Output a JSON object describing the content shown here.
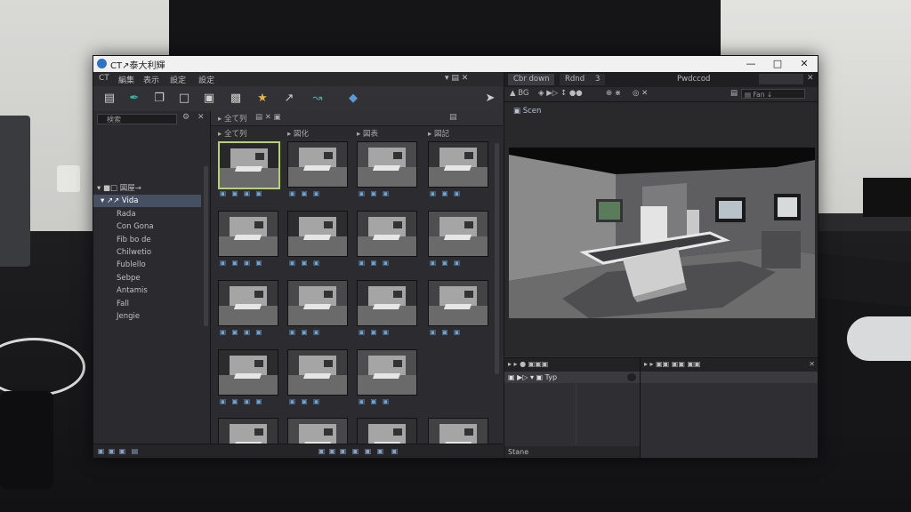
{
  "window": {
    "title": "CT↗泰大利輝"
  },
  "menu": [
    "CT",
    "編集",
    "表示",
    "設定"
  ],
  "toolbar_icons": [
    "list-icon",
    "pen-icon",
    "copy-icon",
    "crop-icon",
    "monitor-icon",
    "layers-icon",
    "star-icon",
    "brush-icon",
    "wand-icon",
    "link-icon",
    "arrow-icon"
  ],
  "tree": {
    "search_placeholder": "検索",
    "items": [
      {
        "label": "▾ ■□ 図屋→",
        "selected": false
      },
      {
        "label": "▾ ↗↗ Vida",
        "selected": true
      },
      {
        "label": "Rada",
        "selected": false
      },
      {
        "label": "Con Gona",
        "selected": false
      },
      {
        "label": "Fib bo de",
        "selected": false
      },
      {
        "label": "Chilwetio",
        "selected": false
      },
      {
        "label": "Fublello",
        "selected": false
      },
      {
        "label": "Sebpe",
        "selected": false
      },
      {
        "label": "Antamis",
        "selected": false
      },
      {
        "label": "Fall",
        "selected": false
      },
      {
        "label": "Jengie",
        "selected": false
      }
    ]
  },
  "grid": {
    "columns": [
      "▸ 全て列",
      "▸ 図化",
      "▸ 図表",
      "▸ 図記"
    ],
    "tags": [
      "▣ ▣ ▣ ▣",
      "▣ ▣ ▣",
      "▣ ▣ ▣",
      "▣ ▣ ▣"
    ]
  },
  "viewport": {
    "tabs": [
      "Cbr down",
      "Rdnd",
      "3"
    ],
    "title": "Pwdccod",
    "toolbar": [
      "▲ BG",
      "◈ ▶▷ ↕ ●●",
      "⊕ ⋇",
      "◎ ✕"
    ],
    "search_placeholder": "▤ Fan ↓",
    "scene_label": "▣ Scen"
  },
  "bottom_left": {
    "header": "▸ ▸  ● ▣▣▣",
    "row": "▣  ▶▷ ▾  ▣ Typ",
    "footer": "Stane"
  },
  "bottom_right": {
    "header": "▸ ▸ ▣▣  ▣▣ ▣▣"
  },
  "colors": {
    "accent": "#465063",
    "selection": "#b7d26a"
  }
}
